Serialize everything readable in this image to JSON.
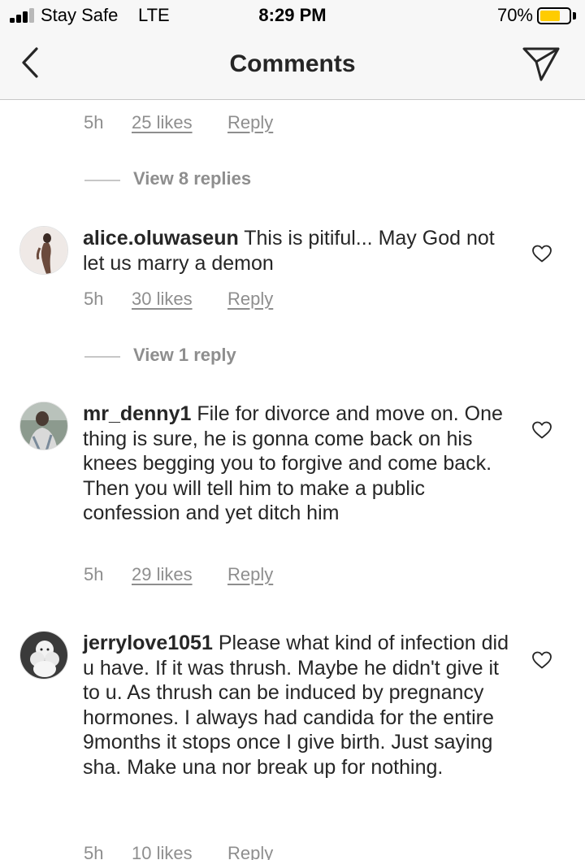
{
  "status_bar": {
    "carrier": "Stay Safe",
    "network": "LTE",
    "time": "8:29 PM",
    "battery_percent": "70%",
    "battery_level": 0.7,
    "battery_color": "#ffcc00"
  },
  "nav": {
    "title": "Comments",
    "back_icon": "chevron-left-icon",
    "share_icon": "paper-plane-icon"
  },
  "top_meta": {
    "time": "5h",
    "likes": "25 likes",
    "reply": "Reply"
  },
  "top_view_replies": "View 8 replies",
  "comments": [
    {
      "username": "alice.oluwaseun",
      "text": "This is pitiful... May God not let us marry a demon",
      "time": "5h",
      "likes": "30 likes",
      "reply": "Reply",
      "view_replies": "View 1 reply"
    },
    {
      "username": "mr_denny1",
      "text": "File for divorce and move on. One thing is sure, he is gonna come back on his knees begging you to forgive and come back. Then you will tell him to make a public confession and yet ditch him",
      "time": "5h",
      "likes": "29 likes",
      "reply": "Reply"
    },
    {
      "username": "jerrylove1051",
      "text": "Please what kind of infection did u have. If it was thrush. Maybe he didn't give it to u. As thrush can be induced by pregnancy hormones. I always had candida for the entire 9months it stops once I give birth. Just saying sha. Make una nor break up for nothing.",
      "time": "5h",
      "likes": "10 likes",
      "reply": "Reply"
    }
  ],
  "colors": {
    "secondary_text": "#8e8e8e",
    "primary_text": "#262626",
    "bar_background": "#f7f7f7"
  }
}
